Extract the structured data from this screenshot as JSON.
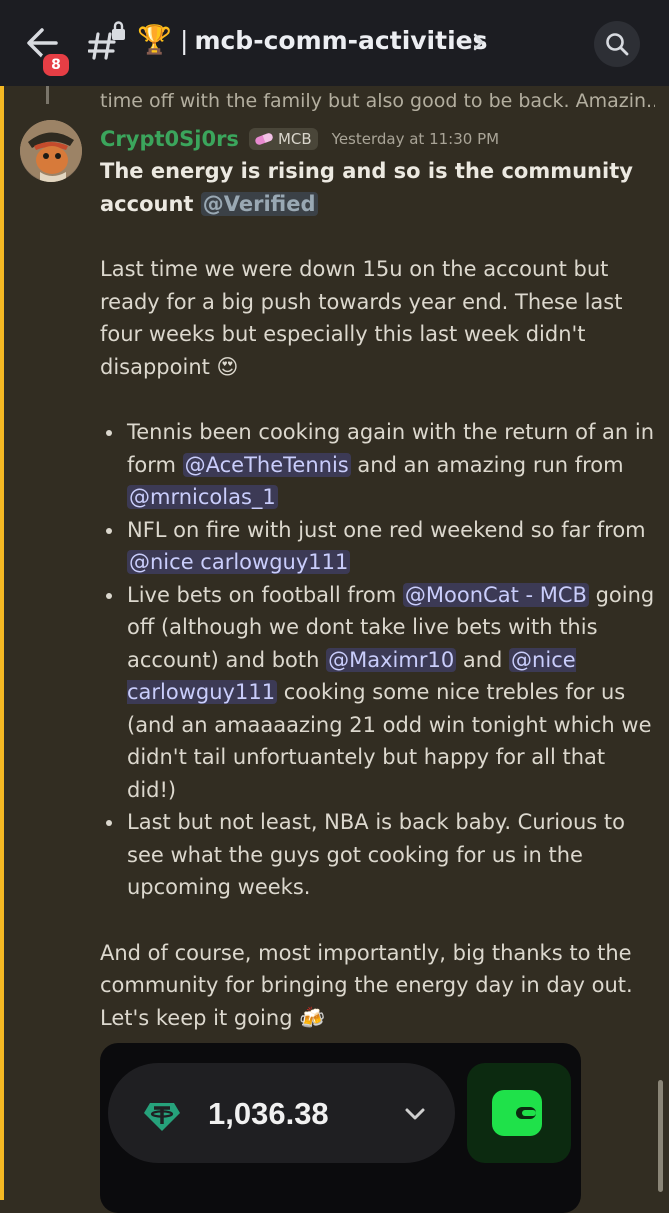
{
  "header": {
    "unread_count": "8",
    "channel_name": "mcb-comm-activities",
    "separator": "|"
  },
  "reply": {
    "text": "time off with the family but also good to be back. Amazin..."
  },
  "message": {
    "username": "Crypt0Sj0rs",
    "tag": "MCB",
    "timestamp": "Yesterday at 11:30 PM",
    "headline": "The energy is rising and so is the community account ",
    "headline_mention": "@Verified",
    "para1": "Last time we were down 15u on the account but ready for a big push towards year end. These last four weeks but especially this last week didn't disappoint ",
    "para1_emoji": "😍",
    "bullets": [
      {
        "t1": "Tennis been cooking again with the return of an in form ",
        "m1": "@AceTheTennis",
        "t2": " and an amazing run from ",
        "m2": "@mrnicolas_1"
      },
      {
        "t1": "NFL on fire with just one red weekend so far from ",
        "m1": "@nice carlowguy111"
      },
      {
        "t1": "Live bets on football from ",
        "m1": "@MoonCat - MCB",
        "t2": " going off (although we dont take live bets with this account) and both ",
        "m2": "@Maximr10",
        "t3": " and ",
        "m3": "@nice carlowguy111",
        "t4": " cooking some nice trebles for us (and an amaaaazing 21 odd win tonight which we didn't tail unfortuantely but happy for all that did!)"
      },
      {
        "t1": "Last but not least, NBA is back baby. Curious to see what the guys got cooking for us in the upcoming weeks."
      }
    ],
    "para2": "And of course, most importantly, big thanks to the community for bringing the energy day in day out. Let's keep it going ",
    "para2_emoji": "🍻"
  },
  "embed": {
    "balance": "1,036.38",
    "coin_icon": "tether-icon",
    "wallet_icon": "wallet-icon"
  },
  "colors": {
    "accent_bar": "#f4b823",
    "username": "#3ba55c",
    "mention_bg": "#3c3a55",
    "wallet": "#1fe14a"
  }
}
